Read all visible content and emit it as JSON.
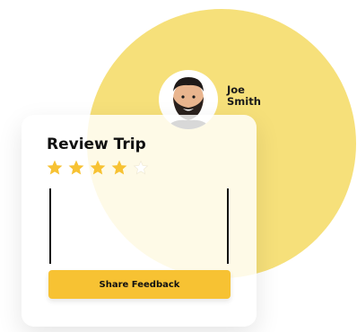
{
  "user": {
    "name": "Joe\nSmith"
  },
  "review": {
    "title": "Review Trip",
    "rating": 4,
    "max_rating": 5,
    "comment_value": "",
    "share_label": "Share Feedback"
  },
  "colors": {
    "accent_circle": "#f6e07a",
    "star_filled": "#f7c233",
    "star_empty": "#ffffff",
    "button": "#f7c233"
  }
}
